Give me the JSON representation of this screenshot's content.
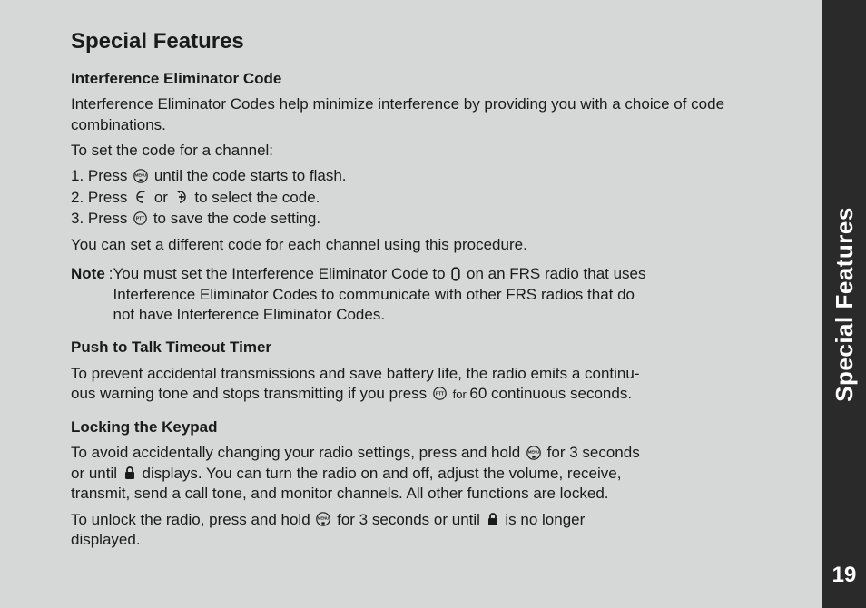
{
  "sidebar": {
    "label": "Special Features",
    "page_number": "19"
  },
  "heading": "Special Features",
  "sections": {
    "iec": {
      "title": "Interference Eliminator Code",
      "intro": "Interference Eliminator Codes help minimize interference by providing you with a choice of code combinations.",
      "to_set": "To set the code for a channel:",
      "steps": {
        "s1a": "1. Press ",
        "s1b": " until the code starts to flash.",
        "s2a": "2. Press ",
        "s2mid": " or ",
        "s2b": " to select the code.",
        "s3a": "3. Press ",
        "s3b": " to save the code setting."
      },
      "after": "You can set a different code for each channel using this procedure.",
      "note_label": "Note",
      "note_colon": ": ",
      "note_line1a": "You must set the Interference Eliminator Code to ",
      "note_line1b": " on an FRS radio that uses",
      "note_line2": "Interference Eliminator Codes to communicate with other FRS radios that do",
      "note_line3": "not have Interference Eliminator Codes."
    },
    "ptt": {
      "title": "Push to Talk Timeout Timer",
      "p1a": "To prevent accidental transmissions and save battery life, the radio emits a continu-",
      "p2a": "ous warning tone and stops transmitting if you press ",
      "p2mid": " for ",
      "p2b": "60 continuous seconds."
    },
    "lock": {
      "title": "Locking the Keypad",
      "p1a": "To avoid accidentally changing your radio settings, press and hold ",
      "p1b": " for 3 seconds",
      "p2a": "or until ",
      "p2b": " displays. You can turn the radio on and off, adjust the volume, receive,",
      "p3": "transmit, send a call tone, and monitor channels. All other functions are locked.",
      "p4a": "To unlock the radio, press and hold ",
      "p4b": " for 3 seconds or until ",
      "p4c": " is no longer",
      "p5": "displayed."
    }
  }
}
